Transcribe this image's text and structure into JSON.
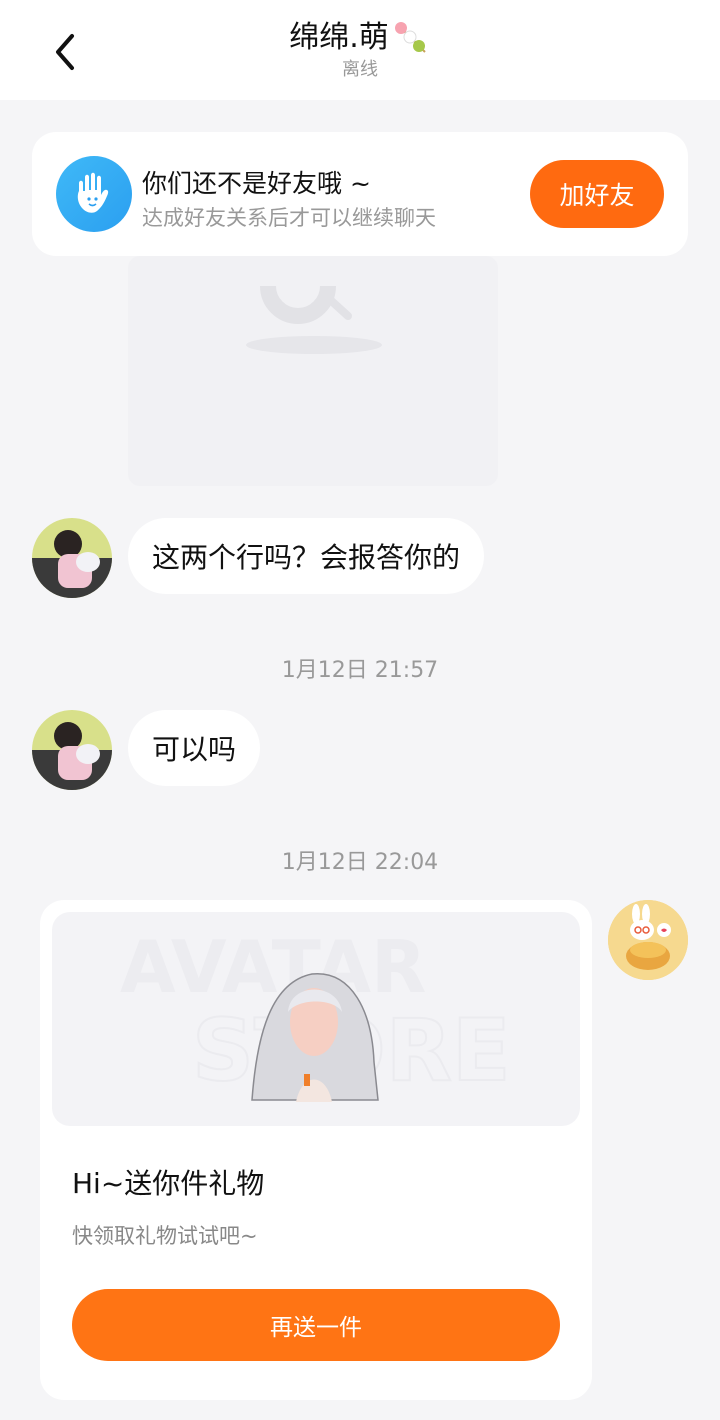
{
  "header": {
    "title": "绵绵.萌",
    "status": "离线"
  },
  "friend_banner": {
    "title": "你们还不是好友哦 ~",
    "subtitle": "达成好友关系后才可以继续聊天",
    "button_label": "加好友"
  },
  "messages": [
    {
      "text": "这两个行吗？会报答你的"
    },
    {
      "text": "可以吗"
    }
  ],
  "timestamps": [
    "1月12日 21:57",
    "1月12日 22:04"
  ],
  "gift_card": {
    "banner_watermark_top": "AVATAR",
    "banner_watermark_bottom": "STORE",
    "title": "Hi~送你件礼物",
    "subtitle": "快领取礼物试试吧~",
    "button_label": "再送一件"
  },
  "colors": {
    "accent": "#ff6a10",
    "background": "#f5f5f7",
    "hand_icon": "#2b9ff0"
  },
  "icons": [
    "back-arrow-icon",
    "tanghulu-emoji-icon",
    "hand-wave-icon"
  ]
}
